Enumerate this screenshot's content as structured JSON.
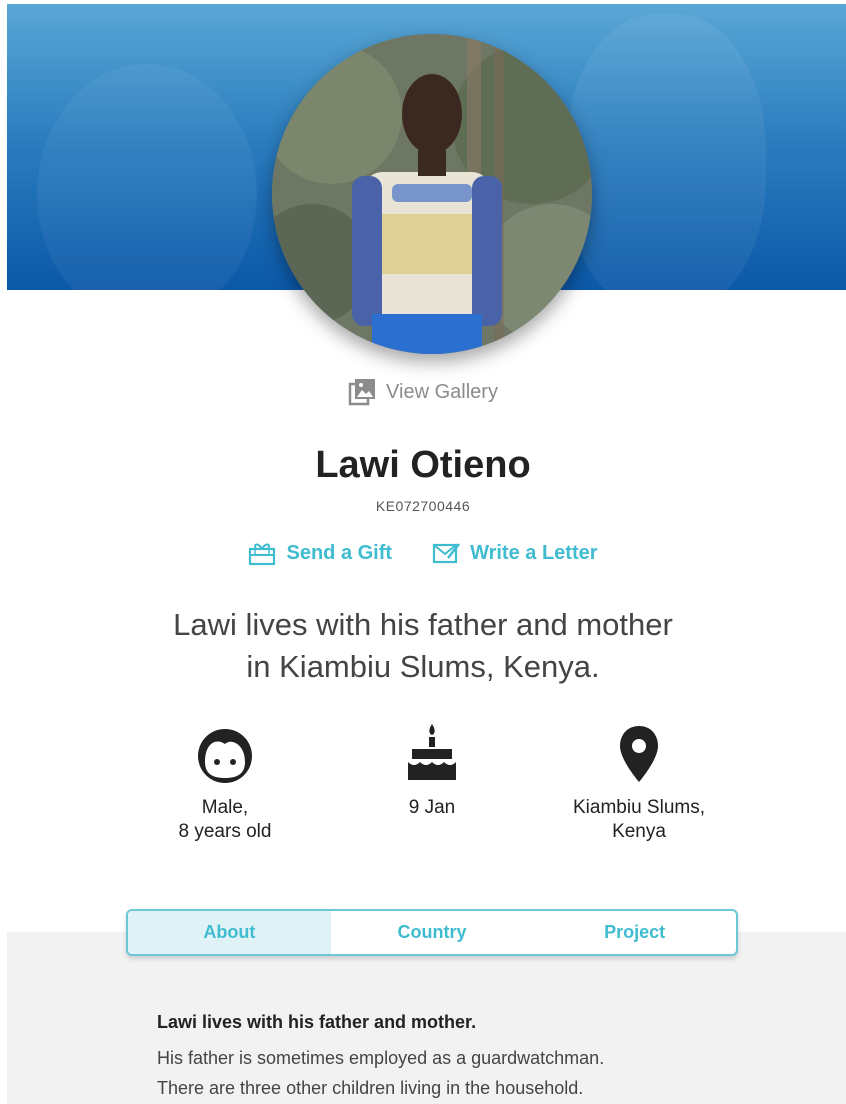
{
  "colors": {
    "accent": "#3fbcd0",
    "hero_top": "#5aa7d6",
    "hero_bottom": "#0b58a8",
    "band": "#f2f2f2"
  },
  "gallery": {
    "label": "View Gallery",
    "icon": "gallery-icon"
  },
  "profile": {
    "name": "Lawi Otieno",
    "id": "KE072700446"
  },
  "actions": {
    "gift_label": "Send a Gift",
    "letter_label": "Write a Letter"
  },
  "summary": {
    "line1": "Lawi lives with his father and mother",
    "line2": "in Kiambiu Slums, Kenya."
  },
  "facts": {
    "gender_line1": "Male,",
    "gender_line2": "8 years old",
    "birthday": "9 Jan",
    "location_line1": "Kiambiu Slums,",
    "location_line2": "Kenya"
  },
  "tabs": {
    "about": "About",
    "country": "Country",
    "project": "Project"
  },
  "about": {
    "title": "Lawi lives with his father and mother.",
    "line1": "His father is sometimes employed as a guardwatchman.",
    "line2": "There are three other children living in the household."
  }
}
